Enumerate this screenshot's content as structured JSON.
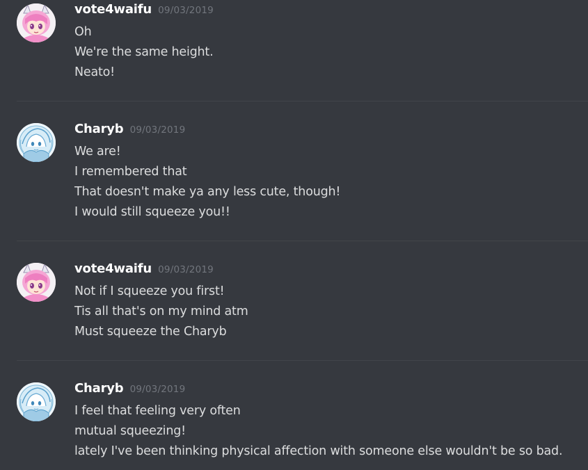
{
  "messages": [
    {
      "author": "vote4waifu",
      "timestamp": "09/03/2019",
      "avatar_icon": "anime-pink-hair-avatar-icon",
      "lines": [
        "Oh",
        "We're the same height.",
        "Neato!"
      ]
    },
    {
      "author": "Charyb",
      "timestamp": "09/03/2019",
      "avatar_icon": "anime-blue-sketch-avatar-icon",
      "lines": [
        "We are!",
        "I remembered that",
        "That doesn't make ya any less cute, though!",
        "I would still squeeze you!!"
      ]
    },
    {
      "author": "vote4waifu",
      "timestamp": "09/03/2019",
      "avatar_icon": "anime-pink-hair-avatar-icon",
      "lines": [
        "Not if I squeeze you first!",
        "Tis all that's on my mind atm",
        "Must squeeze the Charyb"
      ]
    },
    {
      "author": "Charyb",
      "timestamp": "09/03/2019",
      "avatar_icon": "anime-blue-sketch-avatar-icon",
      "lines": [
        "I feel that feeling very often",
        "mutual squeezing!",
        "lately I've been thinking physical affection with someone else wouldn't be so bad."
      ]
    }
  ],
  "colors": {
    "background": "#36393f",
    "username": "#ffffff",
    "timestamp": "#72767d",
    "message_text": "#dcddde",
    "divider": "#42454a"
  }
}
